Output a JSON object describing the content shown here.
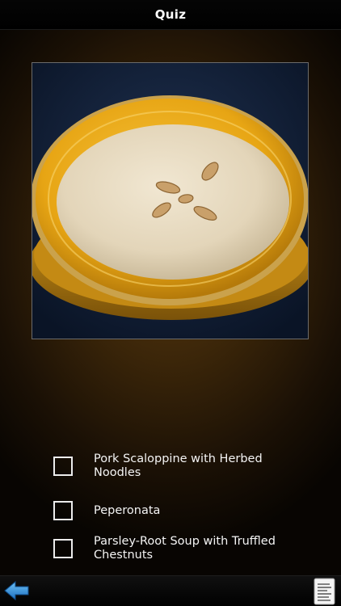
{
  "header": {
    "title": "Quiz"
  },
  "quiz": {
    "image_icon": "soup-photo",
    "options": [
      {
        "label": "Pork Scaloppine with Herbed Noodles",
        "checked": false
      },
      {
        "label": "Peperonata",
        "checked": false
      },
      {
        "label": "Parsley-Root Soup with Truffled Chestnuts",
        "checked": false
      }
    ]
  },
  "toolbar": {
    "back_icon": "back-arrow-icon",
    "notes_icon": "notes-icon",
    "accent_color": "#2f8fd8"
  }
}
